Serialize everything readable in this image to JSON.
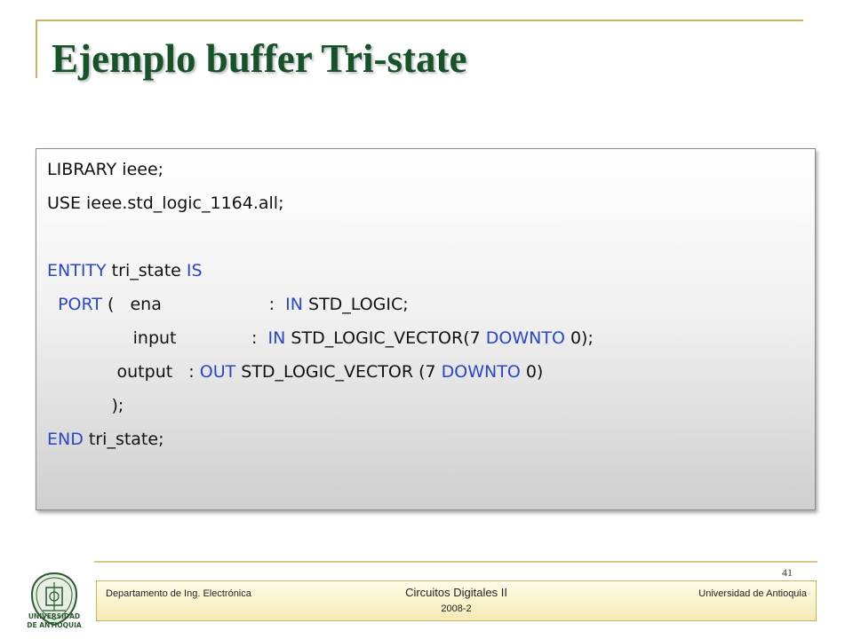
{
  "slide": {
    "title": "Ejemplo buffer Tri-state",
    "page_number": "41"
  },
  "code": {
    "lines": [
      [
        {
          "t": "LIBRARY ieee;"
        }
      ],
      [
        {
          "t": "USE ieee.std_logic_1164.all;"
        }
      ],
      [],
      [
        {
          "t": "ENTITY",
          "kw": true
        },
        {
          "t": " tri_state "
        },
        {
          "t": "IS",
          "kw": true
        }
      ],
      [
        {
          "t": "  PORT",
          "kw": true
        },
        {
          "t": " (   ena                    :  "
        },
        {
          "t": "IN",
          "kw": true
        },
        {
          "t": " STD_LOGIC;"
        }
      ],
      [
        {
          "t": "                input              :  "
        },
        {
          "t": "IN",
          "kw": true
        },
        {
          "t": " STD_LOGIC_VECTOR(7 "
        },
        {
          "t": "DOWNTO",
          "kw": true
        },
        {
          "t": " 0);"
        }
      ],
      [
        {
          "t": "             output   : "
        },
        {
          "t": "OUT",
          "kw": true
        },
        {
          "t": " STD_LOGIC_VECTOR (7 "
        },
        {
          "t": "DOWNTO",
          "kw": true
        },
        {
          "t": " 0)"
        }
      ],
      [
        {
          "t": "            );"
        }
      ],
      [
        {
          "t": "END",
          "kw": true
        },
        {
          "t": " tri_state;"
        }
      ]
    ],
    "keyword_color": "#2a47c8",
    "text_color": "#111111"
  },
  "footer": {
    "left": "Departamento de Ing. Electrónica",
    "center": "Circuitos Digitales II",
    "center_sub": "2008-2",
    "right": "Universidad de Antioquia"
  },
  "logo": {
    "line1": "UNIVERSIDAD",
    "line2": "DE ANTIOQUIA",
    "icon": "university-seal-icon"
  },
  "colors": {
    "title": "#16522a",
    "accent_rule": "#c9b463"
  }
}
